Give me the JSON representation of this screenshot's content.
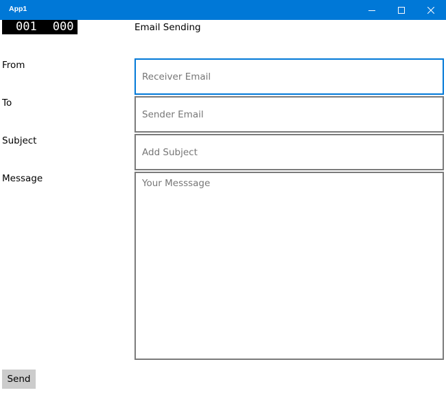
{
  "window": {
    "title": "App1",
    "accent_color": "#0078d7",
    "controls": [
      "minimize-icon",
      "maximize-icon",
      "close-icon"
    ]
  },
  "frame_counter": {
    "left": "001",
    "right": "000"
  },
  "page": {
    "title": "Email Sending"
  },
  "form": {
    "from_label": "From",
    "to_label": "To",
    "subject_label": "Subject",
    "message_label": "Message",
    "from_placeholder": "Receiver Email",
    "to_placeholder": "Sender Email",
    "subject_placeholder": "Add Subject",
    "message_placeholder": "Your Messsage",
    "from_value": "",
    "to_value": "",
    "subject_value": "",
    "message_value": "",
    "focused_field": "from"
  },
  "actions": {
    "send_label": "Send"
  }
}
